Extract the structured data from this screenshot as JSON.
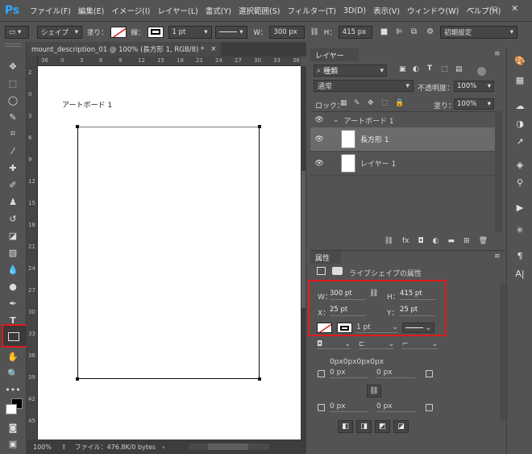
{
  "app": {
    "logo": "Ps"
  },
  "menu": [
    "ファイル(F)",
    "編集(E)",
    "イメージ(I)",
    "レイヤー(L)",
    "書式(Y)",
    "選択範囲(S)",
    "フィルター(T)",
    "3D(D)",
    "表示(V)",
    "ウィンドウ(W)",
    "ヘルプ(H)"
  ],
  "options": {
    "shape_mode": "シェイプ",
    "fill_label": "塗り：",
    "stroke_label": "線：",
    "stroke_width": "1 pt",
    "w_label": "W：",
    "w_value": "300 px",
    "h_label": "H：",
    "h_value": "415 px",
    "workspace": "初期設定"
  },
  "document": {
    "tab_title": "mount_description_01 @ 100% (長方形 1, RGB/8) *",
    "artboard_label": "アートボード 1",
    "ruler_top": [
      "36",
      "0",
      "3",
      "6",
      "9",
      "12",
      "15",
      "18",
      "21",
      "24",
      "27",
      "30",
      "33",
      "36"
    ],
    "ruler_left": [
      "2",
      "0",
      "3",
      "6",
      "9",
      "12",
      "15",
      "18",
      "21",
      "24",
      "27",
      "30",
      "33",
      "36",
      "39",
      "42",
      "45"
    ],
    "zoom": "100%",
    "file_info": "ファイル：476.8K/0 bytes"
  },
  "layers_panel": {
    "tab": "レイヤー",
    "filter_kind": "種類",
    "blend_mode": "通常",
    "opacity_label": "不透明度：",
    "opacity_value": "100%",
    "lock_label": "ロック：",
    "fill_label": "塗り：",
    "fill_value": "100%",
    "artboard_group": "アートボード 1",
    "layers": [
      {
        "name": "長方形 1",
        "selected": true
      },
      {
        "name": "レイヤー 1",
        "selected": false
      }
    ]
  },
  "properties_panel": {
    "tab": "属性",
    "heading": "ライブシェイプの属性",
    "w_label": "W：",
    "w_value": "300 pt",
    "h_label": "H：",
    "h_value": "415 pt",
    "x_label": "X：",
    "x_value": "25 pt",
    "y_label": "Y：",
    "y_value": "25 pt",
    "stroke_width": "1 pt",
    "corner_values": "0px0px0px0px",
    "corner_tl": "0 px",
    "corner_tr": "0 px",
    "corner_bl": "0 px",
    "corner_br": "0 px"
  },
  "colors": {
    "app_bg": "#535353",
    "accent_ps": "#31a8ff",
    "highlight_red": "#e01b1b"
  }
}
